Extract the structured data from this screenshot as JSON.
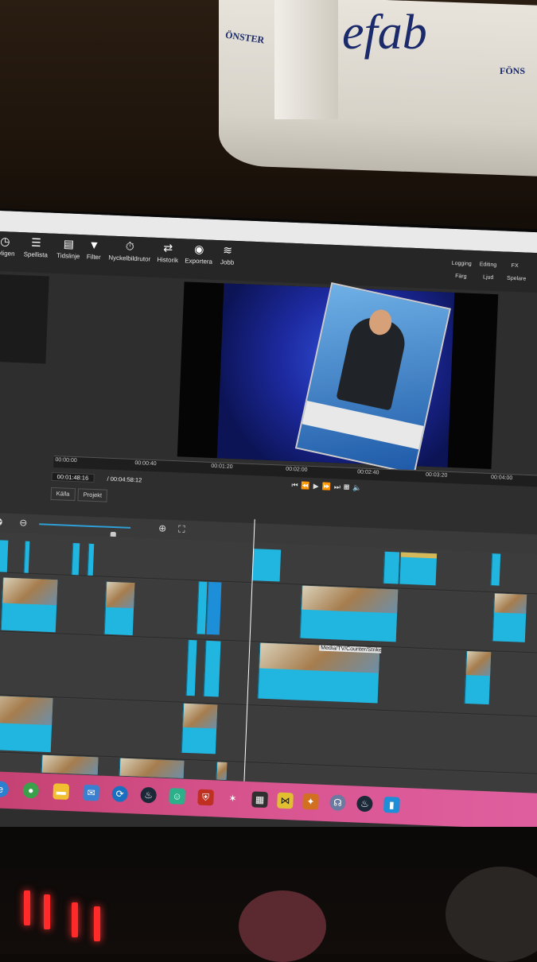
{
  "photo": {
    "towel_logo_left": "ÖNSTER",
    "towel_logo_center": "efab",
    "towel_logo_right": "FÖNS"
  },
  "toolbar": {
    "items": [
      {
        "label": "nyligen",
        "icon": "clock-icon"
      },
      {
        "label": "Spellista",
        "icon": "list-icon"
      },
      {
        "label": "Tidslinje",
        "icon": "timeline-icon"
      },
      {
        "label": "Filter",
        "icon": "filter-icon"
      },
      {
        "label": "Nyckelbildrutor",
        "icon": "stopwatch-icon"
      },
      {
        "label": "Historik",
        "icon": "history-icon"
      },
      {
        "label": "Exportera",
        "icon": "disc-icon"
      },
      {
        "label": "Jobb",
        "icon": "stack-icon"
      }
    ],
    "layouts": [
      "Logging",
      "Editing",
      "FX",
      "Färg",
      "Ljud",
      "Spelare"
    ]
  },
  "player": {
    "ruler_ticks": [
      "00:00:00",
      "00:00:40",
      "00:01:20",
      "00:02:00",
      "00:02:40",
      "00:03:20",
      "00:04:00"
    ],
    "current_time": "00:01:48:16",
    "total_time": "/ 00:04:58:12",
    "tabs": [
      "Källa",
      "Projekt"
    ]
  },
  "timeline": {
    "clip_label": "Media/TV/Counter/StrikeG"
  },
  "colors": {
    "clip": "#20b6e0",
    "taskbar": "#d85590",
    "timeline_bg": "#404040"
  },
  "taskbar": {
    "icons": [
      "windows-icon",
      "edge-icon",
      "chrome-icon",
      "folder-icon",
      "mail-icon",
      "shotcut-icon",
      "steam-icon",
      "discord-icon",
      "shield-icon",
      "settings-icon",
      "game-icon",
      "mask-icon",
      "csgo-icon",
      "headset-icon",
      "steam-icon-2",
      "app-icon"
    ]
  }
}
